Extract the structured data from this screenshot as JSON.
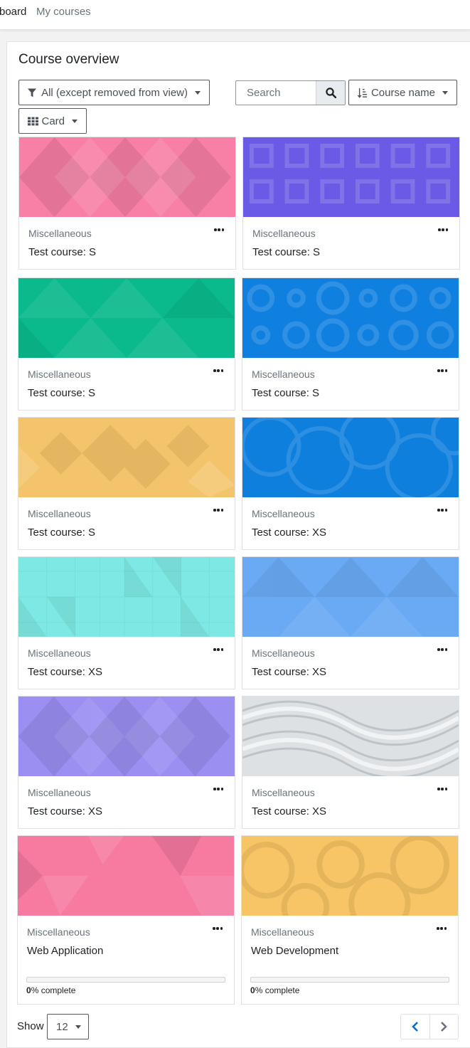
{
  "nav": {
    "dashboard": "board",
    "my_courses": "My courses"
  },
  "overview": {
    "title": "Course overview",
    "filter_label": "All (except removed from view)",
    "search_placeholder": "Search",
    "sort_label": "Course name",
    "view_label": "Card"
  },
  "courses": [
    {
      "category": "Miscellaneous",
      "name": "Test course: S"
    },
    {
      "category": "Miscellaneous",
      "name": "Test course: S"
    },
    {
      "category": "Miscellaneous",
      "name": "Test course: S"
    },
    {
      "category": "Miscellaneous",
      "name": "Test course: S"
    },
    {
      "category": "Miscellaneous",
      "name": "Test course: S"
    },
    {
      "category": "Miscellaneous",
      "name": "Test course: XS"
    },
    {
      "category": "Miscellaneous",
      "name": "Test course: XS"
    },
    {
      "category": "Miscellaneous",
      "name": "Test course: XS"
    },
    {
      "category": "Miscellaneous",
      "name": "Test course: XS"
    },
    {
      "category": "Miscellaneous",
      "name": "Test course: XS"
    },
    {
      "category": "Miscellaneous",
      "name": "Web Application",
      "progress_value": "0",
      "progress_suffix": "% complete",
      "progress": 0
    },
    {
      "category": "Miscellaneous",
      "name": "Web Development",
      "progress_value": "0",
      "progress_suffix": "% complete",
      "progress": 0
    }
  ],
  "card_colors": [
    "#f87fa5",
    "#6a5ae5",
    "#0ab98c",
    "#1080e0",
    "#f4c46c",
    "#0f7fde",
    "#7ee9e4",
    "#6aaaf4",
    "#9b8ff2",
    "#dde1e4",
    "#f77aa1",
    "#f7c566"
  ],
  "pagination": {
    "show_label": "Show",
    "per_page": "12"
  },
  "icons": {
    "filter": "filter-icon",
    "search": "search-icon",
    "sort": "sort-alpha-icon",
    "view": "grid-icon",
    "more": "ellipsis-icon",
    "prev": "chevron-left-icon",
    "next": "chevron-right-icon"
  }
}
